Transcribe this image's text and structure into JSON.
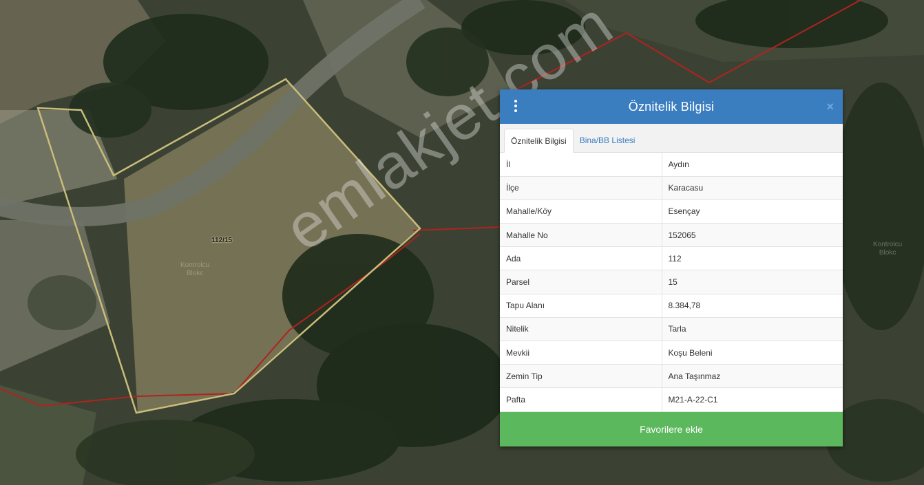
{
  "map": {
    "parcel_label": "112/15",
    "ghost_label_1": "Kontrolcu\nBlokc",
    "ghost_label_2": "Kontrolcu\nBlokc",
    "watermark": "emlakjet.com",
    "colors": {
      "parcel_outline": "#c9bd7a",
      "boundary_line": "#b0231f"
    }
  },
  "popup": {
    "title": "Öznitelik Bilgisi",
    "close_label": "×",
    "tabs": [
      {
        "label": "Öznitelik Bilgisi",
        "active": true
      },
      {
        "label": "Bina/BB Listesi",
        "active": false
      }
    ],
    "rows": [
      {
        "key": "İl",
        "value": "Aydın"
      },
      {
        "key": "İlçe",
        "value": "Karacasu"
      },
      {
        "key": "Mahalle/Köy",
        "value": "Esençay"
      },
      {
        "key": "Mahalle No",
        "value": "152065"
      },
      {
        "key": "Ada",
        "value": "112"
      },
      {
        "key": "Parsel",
        "value": "15"
      },
      {
        "key": "Tapu Alanı",
        "value": "8.384,78"
      },
      {
        "key": "Nitelik",
        "value": "Tarla"
      },
      {
        "key": "Mevkii",
        "value": "Koşu Beleni"
      },
      {
        "key": "Zemin Tip",
        "value": "Ana Taşınmaz"
      },
      {
        "key": "Pafta",
        "value": "M21-A-22-C1"
      }
    ],
    "favorite_button": "Favorilere ekle",
    "colors": {
      "header": "#3a7ec0",
      "button": "#5cb85c"
    }
  }
}
